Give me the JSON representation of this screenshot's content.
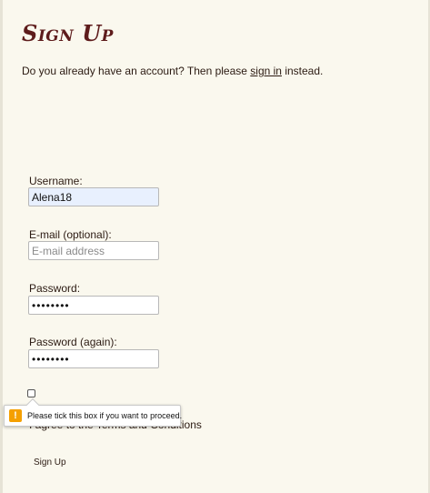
{
  "page": {
    "title": "Sign Up",
    "signin_prefix": "Do you already have an account? Then please ",
    "signin_link": "sign in",
    "signin_suffix": " instead."
  },
  "form": {
    "username": {
      "label": "Username:",
      "value": "Alena18"
    },
    "email": {
      "label": "E-mail (optional):",
      "placeholder": "E-mail address",
      "value": ""
    },
    "password": {
      "label": "Password:",
      "masked_value": "••••••••"
    },
    "password_again": {
      "label": "Password (again):",
      "masked_value": "••••••••"
    },
    "terms": {
      "label": "I agree to the Terms and Conditions",
      "checked": false
    },
    "submit_label": "Sign Up"
  },
  "validation_tooltip": {
    "icon": "warning-icon",
    "icon_glyph": "!",
    "message": "Please tick this box if you want to proceed."
  },
  "colors": {
    "background": "#faf8ee",
    "title": "#5e1c1c",
    "text": "#2b1a12",
    "autofill": "#e8f0fe",
    "warning": "#f5a000"
  }
}
